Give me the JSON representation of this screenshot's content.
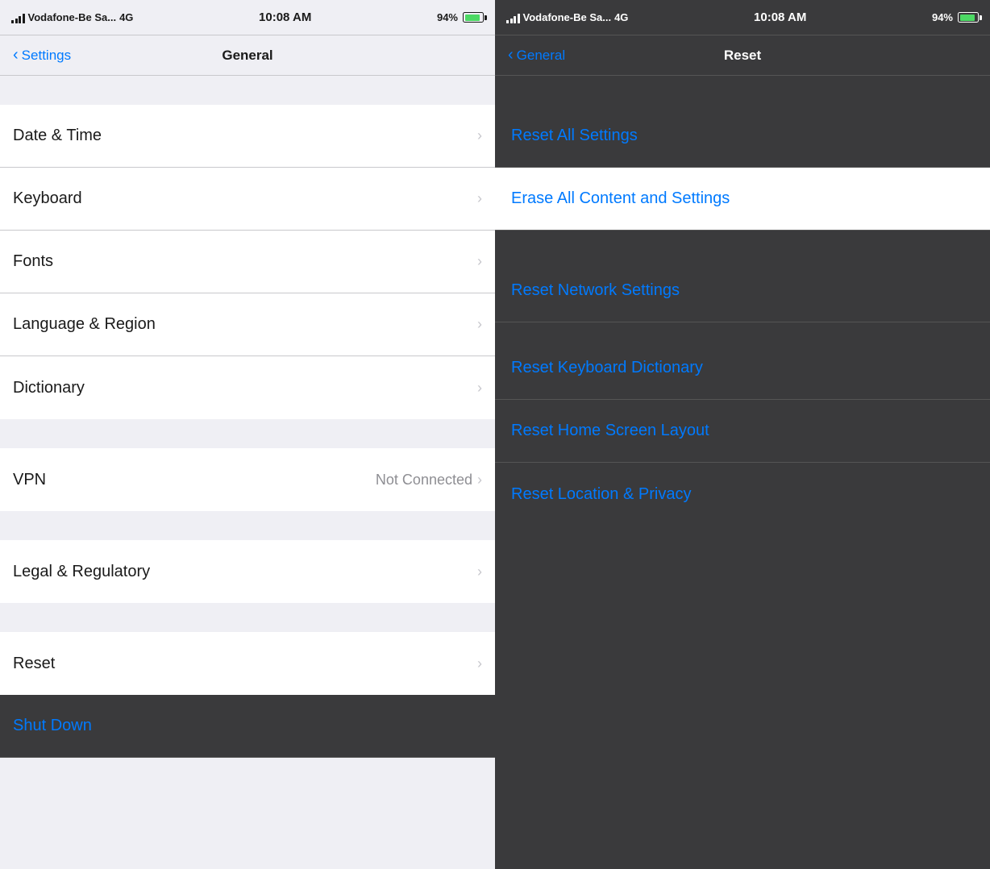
{
  "left": {
    "status": {
      "carrier": "Vodafone-Be Sa...",
      "network": "4G",
      "time": "10:08 AM",
      "battery": "94%"
    },
    "nav": {
      "back_label": "Settings",
      "title": "General"
    },
    "items": [
      {
        "label": "Date & Time",
        "value": "",
        "has_chevron": true
      },
      {
        "label": "Keyboard",
        "value": "",
        "has_chevron": true
      },
      {
        "label": "Fonts",
        "value": "",
        "has_chevron": true
      },
      {
        "label": "Language & Region",
        "value": "",
        "has_chevron": true
      },
      {
        "label": "Dictionary",
        "value": "",
        "has_chevron": true
      }
    ],
    "vpn_item": {
      "label": "VPN",
      "value": "Not Connected",
      "has_chevron": true
    },
    "legal_item": {
      "label": "Legal & Regulatory",
      "value": "",
      "has_chevron": true
    },
    "reset_item": {
      "label": "Reset",
      "value": "",
      "has_chevron": true
    },
    "shutdown_item": {
      "label": "Shut Down",
      "value": "",
      "has_chevron": false
    }
  },
  "right": {
    "status": {
      "carrier": "Vodafone-Be Sa...",
      "network": "4G",
      "time": "10:08 AM",
      "battery": "94%"
    },
    "nav": {
      "back_label": "General",
      "title": "Reset"
    },
    "items": [
      {
        "label": "Reset All Settings",
        "highlighted": false
      },
      {
        "label": "Erase All Content and Settings",
        "highlighted": true
      },
      {
        "label": "Reset Network Settings",
        "highlighted": false
      },
      {
        "label": "Reset Keyboard Dictionary",
        "highlighted": false
      },
      {
        "label": "Reset Home Screen Layout",
        "highlighted": false
      },
      {
        "label": "Reset Location & Privacy",
        "highlighted": false
      }
    ]
  }
}
